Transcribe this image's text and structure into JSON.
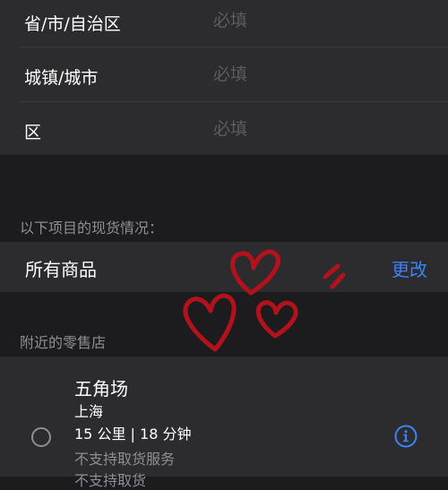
{
  "address_form": {
    "rows": [
      {
        "label": "省/市/自治区",
        "placeholder": "必填"
      },
      {
        "label": "城镇/城市",
        "placeholder": "必填"
      },
      {
        "label": "区",
        "placeholder": "必填"
      }
    ]
  },
  "availability": {
    "section_header": "以下项目的现货情况：",
    "row_label": "所有商品",
    "change_button": "更改"
  },
  "nearby": {
    "section_header": "附近的零售店",
    "stores": [
      {
        "name": "五角场",
        "city": "上海",
        "distance": "15 公里 | 18 分钟",
        "pickup_status": "不支持取货服务",
        "extra_line": "不支持取货"
      }
    ]
  },
  "decoration": {
    "heart_color": "#b3121c"
  },
  "colors": {
    "accent": "#3b82f6",
    "background": "#1c1c1e",
    "card": "#2c2c2e"
  }
}
